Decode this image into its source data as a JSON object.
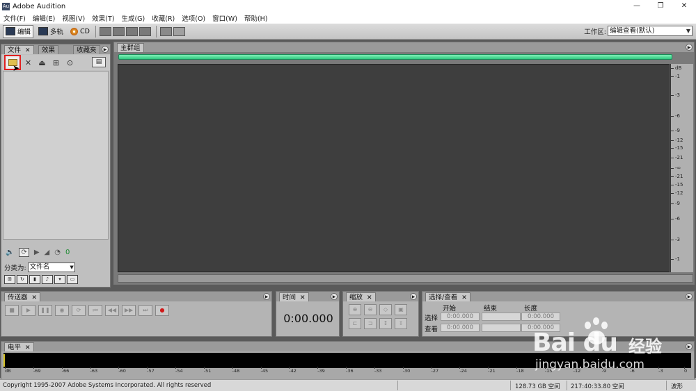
{
  "window": {
    "app_title": "Adobe Audition",
    "minimize": "—",
    "restore": "❐",
    "close": "✕"
  },
  "menu": {
    "items": [
      "文件(F)",
      "编辑(E)",
      "视图(V)",
      "效果(T)",
      "生成(G)",
      "收藏(R)",
      "选项(O)",
      "窗口(W)",
      "帮助(H)"
    ]
  },
  "toolbar": {
    "edit_label": "编辑",
    "multitrack_label": "多轨",
    "cd_label": "CD",
    "workspace_label": "工作区:",
    "workspace_value": "编辑查看(默认)"
  },
  "file_panel": {
    "tabs": [
      "文件",
      "效果",
      "收藏夹"
    ],
    "sort_label": "分类为:",
    "sort_value": "文件名",
    "volume_value": "0"
  },
  "main_group": {
    "tab": "主群组",
    "db_unit": "dB",
    "db_ticks": [
      "-1",
      "-3",
      "-6",
      "-9",
      "-12",
      "-15",
      "-21",
      "-∞",
      "-21",
      "-15",
      "-12",
      "-9",
      "-6",
      "-3",
      "-1"
    ]
  },
  "transport": {
    "tab": "传送器"
  },
  "time": {
    "tab": "时间",
    "display": "0:00.000"
  },
  "zoom": {
    "tab": "缩放"
  },
  "selection": {
    "tab": "选择/查看",
    "headers": [
      "开始",
      "结束",
      "长度"
    ],
    "select_label": "选择",
    "view_label": "查看",
    "select_start": "0:00.000",
    "select_end": "",
    "select_length": "0:00.000",
    "view_start": "0:00.000",
    "view_end": "",
    "view_length": "0:00.000"
  },
  "levels": {
    "tab": "电平",
    "ticks": [
      "dB",
      "-69",
      "-66",
      "-63",
      "-60",
      "-57",
      "-54",
      "-51",
      "-48",
      "-45",
      "-42",
      "-39",
      "-36",
      "-33",
      "-30",
      "-27",
      "-24",
      "-21",
      "-18",
      "-15",
      "-12",
      "-9",
      "-6",
      "-3",
      "0"
    ]
  },
  "status": {
    "copyright": "Copyright 1995-2007 Adobe Systems Incorporated. All rights reserved",
    "disk_free": "128.73 GB 空间",
    "time_free": "217:40:33.80 空间",
    "mode": "波形"
  },
  "watermark": {
    "logo_text": "Bai du",
    "cn_text": "经验",
    "url": "jingyan.baidu.com"
  }
}
